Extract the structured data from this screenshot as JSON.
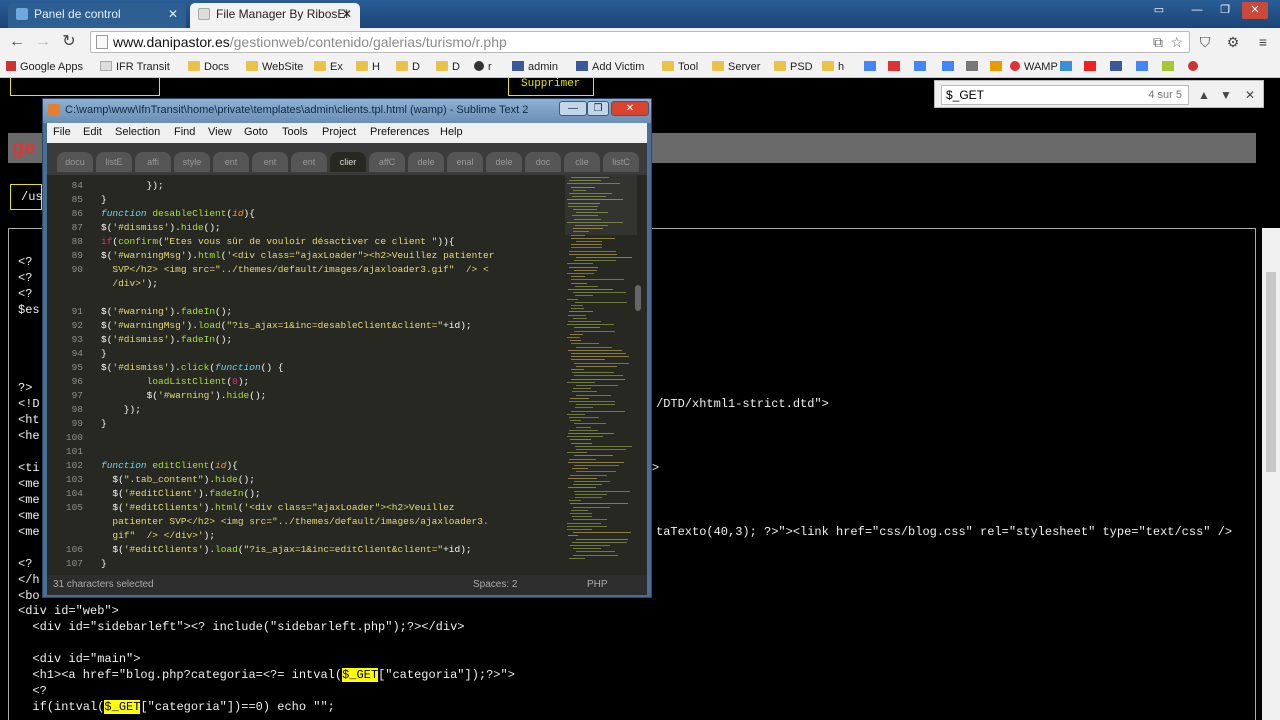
{
  "browser": {
    "tabs": [
      {
        "title": "Panel de control",
        "active": false
      },
      {
        "title": "File Manager By RibosEl",
        "active": true
      }
    ],
    "url": {
      "host": "www.danipastor.es",
      "path": "/gestionweb/contenido/galerias/turismo/r.php"
    },
    "bookmarks": [
      "Google Apps",
      "IFR Transit",
      "Docs",
      "WebSite",
      "Ex",
      "H",
      "D",
      "D",
      "r",
      "admin",
      "Add Victim",
      "Tool",
      "Server",
      "PSD",
      "h",
      "WAMP"
    ],
    "find": {
      "query": "$_GET",
      "count": "4 sur 5"
    }
  },
  "page": {
    "brand": "ge",
    "button_supprimer": "Supprimer",
    "path_box": "/us",
    "lines_left": [
      "<?",
      "<?",
      "<?",
      "$es",
      "?>",
      "<!D",
      "<ht",
      "<he",
      "<ti",
      "<me",
      "<me",
      "<me",
      "<me",
      "<?",
      "</h",
      "<bo"
    ],
    "lines_bottom": [
      "<div id=\"web\">",
      "  <div id=\"sidebarleft\"><? include(\"sidebarleft.php\");?></div>",
      "",
      "  <div id=\"main\">",
      "  <h1><a href=\"blog.php?categoria=<?= intval(",
      "  <?",
      "  if(intval("
    ],
    "hl_word": "$_GET",
    "line_after_hl1": "[\"categoria\"]);?>\">",
    "line_after_hl2": "[\"categoria\"])==0) echo \"\";",
    "dtd_fragment": "/DTD/xhtml1-strict.dtd\">",
    "meta_gt": ">",
    "link_fragment": "taTexto(40,3); ?>\"><link href=\"css/blog.css\" rel=\"stylesheet\" type=\"text/css\" />"
  },
  "sublime": {
    "title": "C:\\wamp\\www\\IfnTransit\\home\\private\\templates\\admin\\clients.tpl.html (wamp) - Sublime Text 2",
    "menu": [
      "File",
      "Edit",
      "Selection",
      "Find",
      "View",
      "Goto",
      "Tools",
      "Project",
      "Preferences",
      "Help"
    ],
    "tabs": [
      "docu",
      "listE",
      "affi",
      "style",
      "ent",
      "ent",
      "ent",
      "clier",
      "affC",
      "dele",
      "enal",
      "dele",
      "doc",
      "clie",
      "listC"
    ],
    "active_tab_index": 7,
    "status_left": "31 characters selected",
    "status_mid": "Spaces: 2",
    "status_right": "PHP",
    "line_numbers": [
      "84",
      "85",
      "86",
      "87",
      "88",
      "89",
      "90",
      "",
      "",
      "91",
      "92",
      "93",
      "94",
      "95",
      "96",
      "97",
      "98",
      "99",
      "100",
      "101",
      "102",
      "103",
      "104",
      "105",
      "",
      "",
      "106",
      "107"
    ]
  },
  "colors": {
    "highlight": "#ffff00",
    "editor_bg": "#272822",
    "chrome_blue": "#1f4f86"
  }
}
